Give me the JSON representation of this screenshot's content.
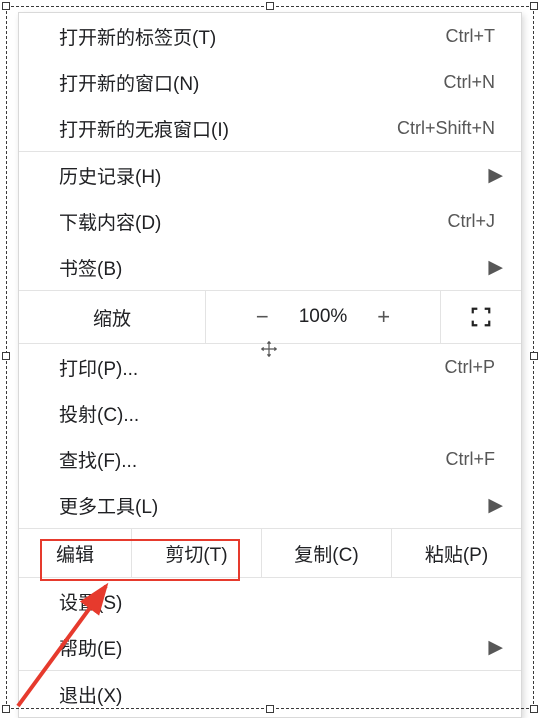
{
  "menu": {
    "new_tab": {
      "label": "打开新的标签页(T)",
      "shortcut": "Ctrl+T"
    },
    "new_window": {
      "label": "打开新的窗口(N)",
      "shortcut": "Ctrl+N"
    },
    "new_incognito": {
      "label": "打开新的无痕窗口(I)",
      "shortcut": "Ctrl+Shift+N"
    },
    "history": {
      "label": "历史记录(H)"
    },
    "downloads": {
      "label": "下载内容(D)",
      "shortcut": "Ctrl+J"
    },
    "bookmarks": {
      "label": "书签(B)"
    },
    "zoom": {
      "label": "缩放",
      "value": "100%",
      "minus": "−",
      "plus": "+"
    },
    "print": {
      "label": "打印(P)...",
      "shortcut": "Ctrl+P"
    },
    "cast": {
      "label": "投射(C)..."
    },
    "find": {
      "label": "查找(F)...",
      "shortcut": "Ctrl+F"
    },
    "more_tools": {
      "label": "更多工具(L)"
    },
    "edit": {
      "label": "编辑",
      "cut": "剪切(T)",
      "copy": "复制(C)",
      "paste": "粘贴(P)"
    },
    "settings": {
      "label": "设置(S)"
    },
    "help": {
      "label": "帮助(E)"
    },
    "exit": {
      "label": "退出(X)"
    }
  }
}
